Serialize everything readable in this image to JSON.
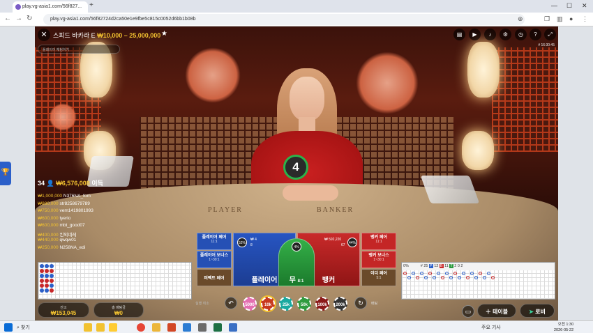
{
  "browser": {
    "tab_title": "play.vg-asia1.com/56f827...",
    "tab_close": "×",
    "new_tab": "+",
    "url": "play.vg-asia1.com/56f82724d2ca50e1e9fbe5c815c0052d6bb1b08b"
  },
  "game": {
    "title": "스피드 바카라 E",
    "limits": "₩10,000 – 25,000,000",
    "game_id": "# 16:30:45",
    "chat_placeholder": "플레이어 채팅하기",
    "timer": "4",
    "players_count": "34",
    "total_won": "₩6,576,008",
    "total_won_suffix": "이득",
    "table_player": "PLAYER",
    "table_banker": "BANKER",
    "winners": [
      {
        "amount": "₩1,000,000",
        "name": "N376NA_fom"
      },
      {
        "amount": "₩880,000",
        "name": "str8258679789"
      },
      {
        "amount": "₩750,000",
        "name": "vem1419801993"
      },
      {
        "amount": "₩600,000",
        "name": "tyerio"
      },
      {
        "amount": "₩600,000",
        "name": "mbt_good07"
      },
      {
        "amount": "₩400,000",
        "name": "킨외네레"
      },
      {
        "amount": "₩440,000",
        "name": "qwqw01"
      },
      {
        "amount": "₩250,000",
        "name": "N258NA_edi"
      }
    ]
  },
  "bets": {
    "player_pair": {
      "label": "플레이어 페어",
      "odds": "11:1"
    },
    "player_bonus": {
      "label": "플레이어 보너스",
      "odds": "1~30:1"
    },
    "perfect_pair": {
      "label": "퍼펙트 페어",
      "odds": ""
    },
    "player": {
      "label": "플레이어",
      "odds": "",
      "pct": "52%",
      "amount": "₩ 4",
      "count": "8"
    },
    "tie": {
      "label": "무",
      "odds": "8:1",
      "pct": "4%"
    },
    "banker": {
      "label": "뱅커",
      "odds": "",
      "pct": "44%",
      "amount": "₩ 592,220",
      "count": "67"
    },
    "banker_pair": {
      "label": "뱅커 페어",
      "odds": "11:1"
    },
    "banker_bonus": {
      "label": "뱅커 보너스",
      "odds": "1~30:1"
    },
    "either_pair": {
      "label": "이더 페어",
      "odds": "5:1"
    }
  },
  "stats": {
    "shoe_pct": "0%",
    "rounds": "# 25",
    "player_wins": "12",
    "banker_wins": "11",
    "ties": "2",
    "player_pairs": "0",
    "banker_pairs": "2",
    "p_label": "P",
    "b_label": "B",
    "t_label": "T"
  },
  "bottom": {
    "balance_label": "잔고",
    "balance_value": "₩153,045",
    "total_bet_label": "총 배팅금",
    "total_bet_value": "₩0",
    "undo_label": "실행 취소",
    "double_label": "배팅",
    "chips": [
      "5000",
      "10k",
      "25k",
      "50k",
      "100k",
      "200k"
    ],
    "chip_colors": [
      "#e46fb1",
      "#c8391e",
      "#1aa9a0",
      "#2f9b3f",
      "#8b1a1a",
      "#333333"
    ],
    "table_btn": "테이블",
    "lobby_btn": "로비"
  },
  "taskbar": {
    "search_label": "찾기",
    "weather": "주요 기사",
    "time": "오전 1:30",
    "date": "2026-05-22"
  }
}
